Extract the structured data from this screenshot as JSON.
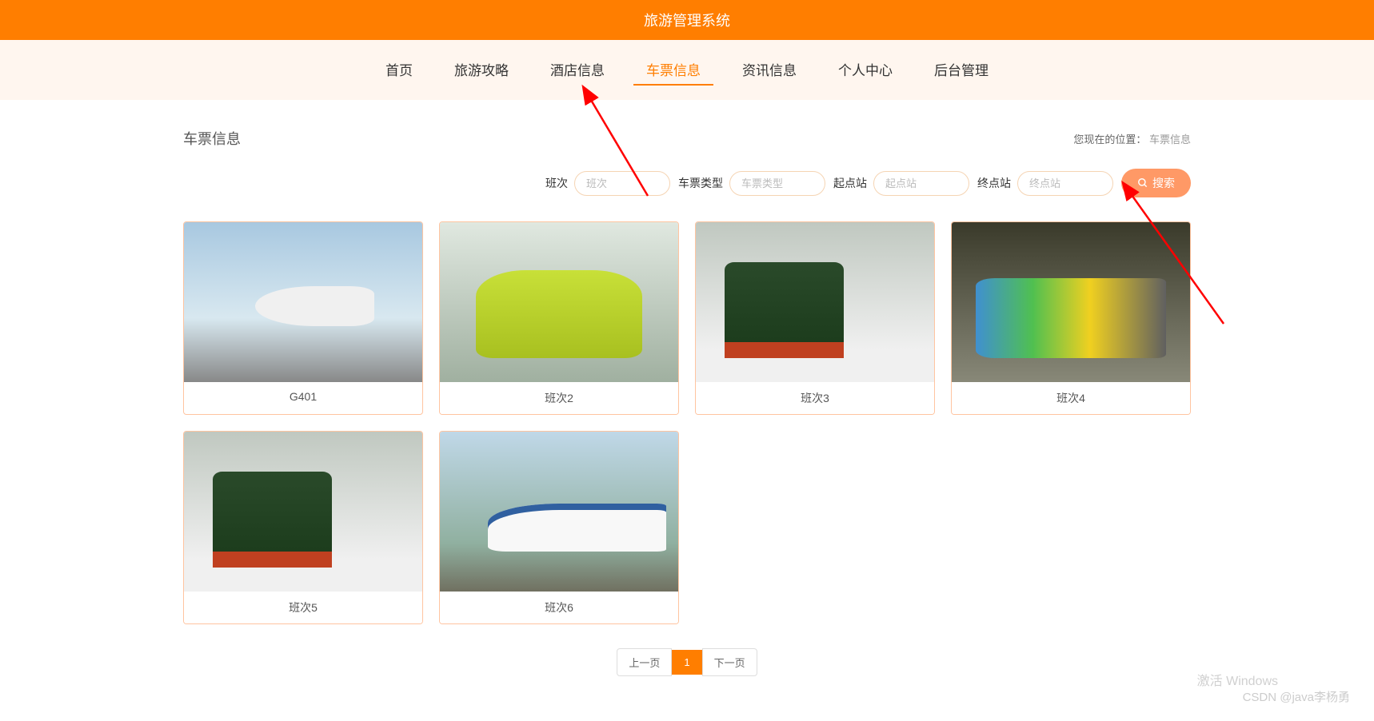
{
  "header": {
    "title": "旅游管理系统"
  },
  "nav": {
    "items": [
      {
        "label": "首页"
      },
      {
        "label": "旅游攻略"
      },
      {
        "label": "酒店信息"
      },
      {
        "label": "车票信息"
      },
      {
        "label": "资讯信息"
      },
      {
        "label": "个人中心"
      },
      {
        "label": "后台管理"
      }
    ],
    "active_index": 3
  },
  "page": {
    "title": "车票信息",
    "breadcrumb_prefix": "您现在的位置：",
    "breadcrumb_current": "车票信息"
  },
  "search": {
    "fields": [
      {
        "label": "班次",
        "placeholder": "班次"
      },
      {
        "label": "车票类型",
        "placeholder": "车票类型"
      },
      {
        "label": "起点站",
        "placeholder": "起点站"
      },
      {
        "label": "终点站",
        "placeholder": "终点站"
      }
    ],
    "button_label": "搜索"
  },
  "cards": [
    {
      "label": "G401",
      "img_class": "img-plane"
    },
    {
      "label": "班次2",
      "img_class": "img-green-train"
    },
    {
      "label": "班次3",
      "img_class": "img-old-train"
    },
    {
      "label": "班次4",
      "img_class": "img-metro"
    },
    {
      "label": "班次5",
      "img_class": "img-old-train"
    },
    {
      "label": "班次6",
      "img_class": "img-bullet"
    }
  ],
  "pagination": {
    "prev": "上一页",
    "next": "下一页",
    "current": "1"
  },
  "watermark": {
    "text1": "激活 Windows",
    "text2": "CSDN @java李杨勇"
  }
}
